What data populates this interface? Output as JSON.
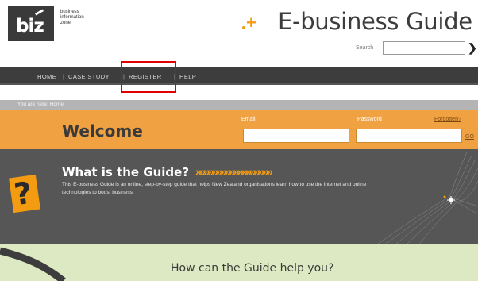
{
  "header": {
    "logo_text": "biz",
    "logo_subtitle": [
      "business",
      "information",
      "zone"
    ],
    "plus_glyph": "+",
    "title": "E-business Guide",
    "search_label": "Search",
    "search_value": "",
    "search_go_glyph": "❯"
  },
  "nav": {
    "items": [
      {
        "label": "HOME"
      },
      {
        "label": "CASE STUDY"
      },
      {
        "label": "REGISTER"
      },
      {
        "label": "HELP"
      }
    ],
    "separator": "|"
  },
  "breadcrumb": "You are here: Home",
  "login": {
    "welcome": "Welcome",
    "email_label": "Email",
    "email_value": "",
    "password_label": "Password",
    "password_value": "",
    "forgot_label": "Forgotten?",
    "go_label": "GO"
  },
  "what": {
    "title": "What is the Guide?",
    "chevrons": "»»»»»»»»»»»»»»»»»»",
    "description": "This E-business Guide is an online, step-by-step guide that helps New Zealand organisations learn how to use the internet and online technologies to boost business.",
    "icon_glyph": "?"
  },
  "help": {
    "title": "How can the Guide help you?"
  },
  "colors": {
    "nav_bg": "#3d3d3d",
    "login_bg": "#f0a142",
    "accent": "#f39c12",
    "what_bg": "#565656",
    "help_bg": "#dde9c2",
    "highlight": "#e00000"
  }
}
